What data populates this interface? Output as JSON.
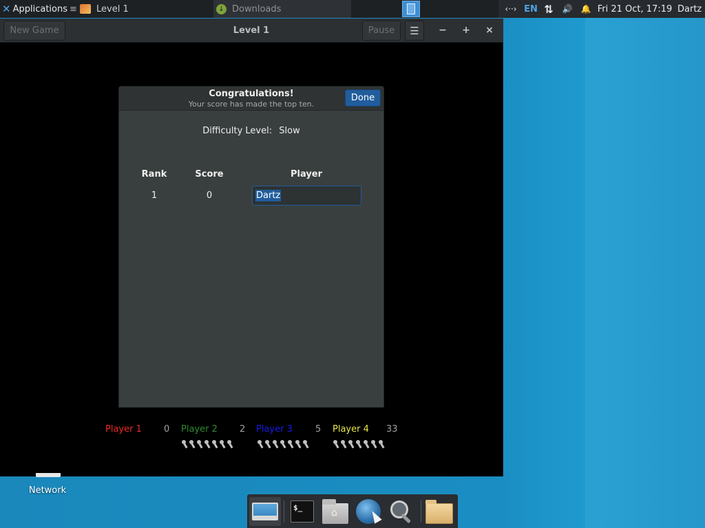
{
  "top_panel": {
    "apps_label": "Applications",
    "apps_extra": "≡",
    "tasks": [
      {
        "label": "Level 1"
      },
      {
        "label": "Downloads"
      }
    ],
    "tray": {
      "network": "‹··›",
      "language": "EN",
      "updown": "⇅",
      "volume": "🔊",
      "bell": "🔔",
      "clock": "Fri 21 Oct, 17:19",
      "user": "Dartz"
    }
  },
  "window": {
    "title": "Level 1",
    "new_game_label": "New Game",
    "pause_label": "Pause",
    "menu_icon": "☰",
    "minimize": "−",
    "maximize": "+",
    "close": "×"
  },
  "dialog": {
    "title": "Congratulations!",
    "subtitle": "Your score has made the top ten.",
    "done_label": "Done",
    "difficulty_label": "Difficulty Level:",
    "difficulty_value": "Slow",
    "columns": [
      "Rank",
      "Score",
      "Player"
    ],
    "rows": [
      {
        "rank": "1",
        "score": "0",
        "player": "Dartz"
      }
    ]
  },
  "scoreboard": [
    {
      "name": "Player 1",
      "score": "0",
      "color": "#ef2929"
    },
    {
      "name": "Player 2",
      "score": "2",
      "color": "#2e8b2e"
    },
    {
      "name": "Player 3",
      "score": "5",
      "color": "#1a1ae8"
    },
    {
      "name": "Player 4",
      "score": "33",
      "color": "#e8e84a"
    }
  ],
  "desktop": {
    "network_label": "Network"
  },
  "dock": {
    "terminal_glyph": "$_"
  },
  "colors": {
    "accent": "#215d9c",
    "desktop_bg": "#1a88bb"
  }
}
